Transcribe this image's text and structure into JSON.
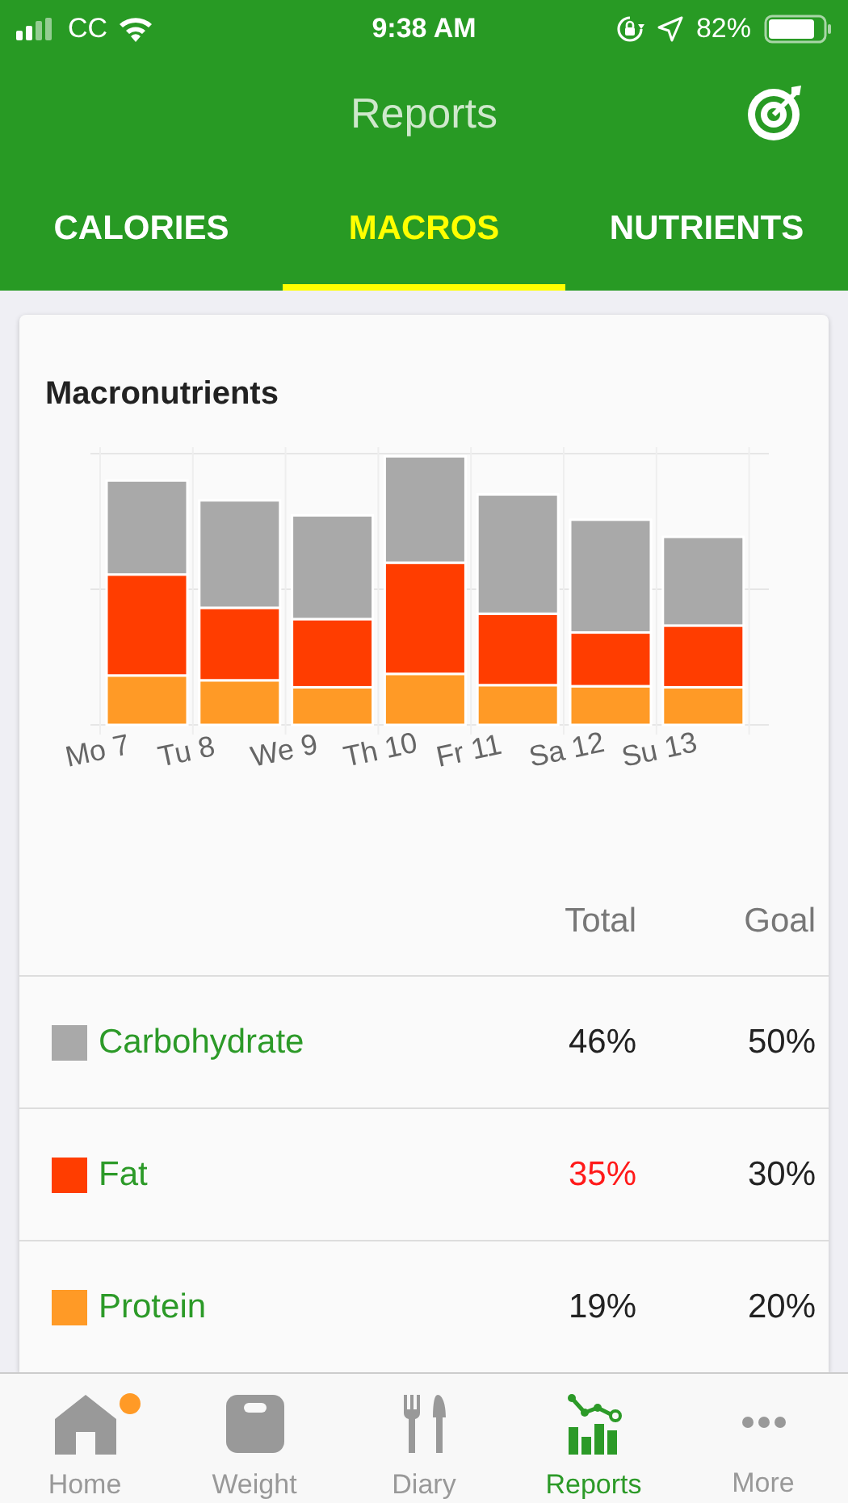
{
  "status_bar": {
    "carrier": "CC",
    "time": "9:38 AM",
    "battery": "82%"
  },
  "header": {
    "title": "Reports"
  },
  "tabs": [
    {
      "label": "CALORIES",
      "selected": false
    },
    {
      "label": "MACROS",
      "selected": true
    },
    {
      "label": "NUTRIENTS",
      "selected": false
    }
  ],
  "card": {
    "title": "Macronutrients",
    "chart": {
      "day_labels": [
        "Mo 7",
        "Tu 8",
        "We 9",
        "Th 10",
        "Fr 11",
        "Sa 12",
        "Su 13"
      ]
    },
    "columns": [
      "Total",
      "Goal"
    ],
    "rows": [
      {
        "name": "Carbohydrate",
        "color": "#a9a9a9",
        "total": "46%",
        "goal": "50%",
        "over_goal": false
      },
      {
        "name": "Fat",
        "color": "#ff3d00",
        "total": "35%",
        "goal": "30%",
        "over_goal": true
      },
      {
        "name": "Protein",
        "color": "#ff9a26",
        "total": "19%",
        "goal": "20%",
        "over_goal": false
      }
    ]
  },
  "nav": [
    {
      "label": "Home",
      "kind": "home",
      "selected": false,
      "notification": true
    },
    {
      "label": "Weight",
      "kind": "weight",
      "selected": false,
      "notification": false
    },
    {
      "label": "Diary",
      "kind": "diary",
      "selected": false,
      "notification": false
    },
    {
      "label": "Reports",
      "kind": "reports",
      "selected": true,
      "notification": false
    },
    {
      "label": "More",
      "kind": "more",
      "selected": false,
      "notification": false
    }
  ]
}
